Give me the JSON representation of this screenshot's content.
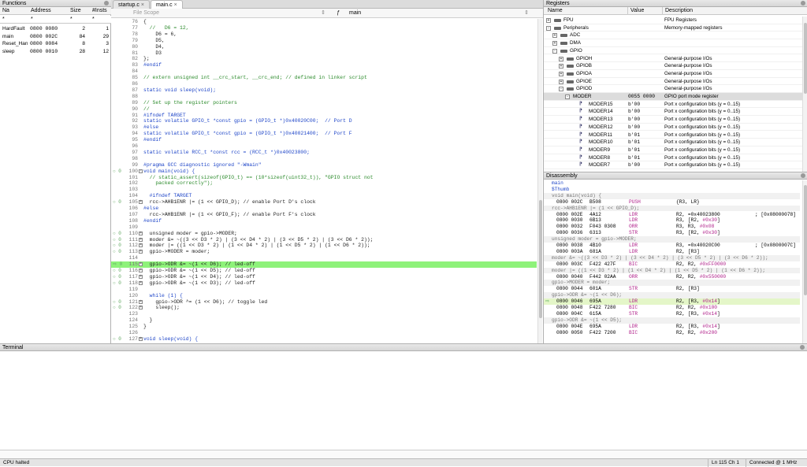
{
  "functions": {
    "title": "Functions",
    "columns": [
      "Na",
      "Address",
      "Size",
      "#Insts"
    ],
    "filters": [
      "*",
      "*",
      "*",
      "*"
    ],
    "rows": [
      {
        "name": "HardFault",
        "address": "0800 0080",
        "size": "2",
        "insts": "1"
      },
      {
        "name": "main",
        "address": "0800 002C",
        "size": "84",
        "insts": "29"
      },
      {
        "name": "Reset_Han",
        "address": "0800 0084",
        "size": "8",
        "insts": "3"
      },
      {
        "name": "sleep",
        "address": "0800 0010",
        "size": "28",
        "insts": "12"
      }
    ]
  },
  "editor": {
    "tabs": [
      "startup.c",
      "main.c"
    ],
    "file_scope": "File Scope",
    "func_symbol": "ƒ",
    "func_name": "main",
    "lines": [
      {
        "n": "76",
        "t": "{"
      },
      {
        "n": "77",
        "t": "  //   D6 = 12,",
        "cls": "c"
      },
      {
        "n": "78",
        "t": "    D6 = 6,"
      },
      {
        "n": "79",
        "t": "    D5,"
      },
      {
        "n": "80",
        "t": "    D4,"
      },
      {
        "n": "81",
        "t": "    D3"
      },
      {
        "n": "82",
        "t": "};"
      },
      {
        "n": "83",
        "t": "#endif",
        "cls": "p"
      },
      {
        "n": "84",
        "t": ""
      },
      {
        "n": "85",
        "t": "// extern unsigned int __crc_start, __crc_end; // defined in linker script",
        "cls": "c"
      },
      {
        "n": "86",
        "t": ""
      },
      {
        "n": "87",
        "t": "static void sleep(void);",
        "cls": "k"
      },
      {
        "n": "88",
        "t": ""
      },
      {
        "n": "89",
        "t": "// Set up the register pointers",
        "cls": "c"
      },
      {
        "n": "90",
        "t": "//",
        "cls": "c"
      },
      {
        "n": "91",
        "t": "#ifndef TARGET",
        "cls": "p"
      },
      {
        "n": "92",
        "t": "static volatile GPIO_t *const gpio = (GPIO_t *)0x40020C00;  // Port D",
        "cls": "k"
      },
      {
        "n": "93",
        "t": "#else",
        "cls": "p"
      },
      {
        "n": "94",
        "t": "static volatile GPIO_t *const gpio = (GPIO_t *)0x40021400;  // Port F",
        "cls": "k"
      },
      {
        "n": "95",
        "t": "#endif",
        "cls": "p"
      },
      {
        "n": "96",
        "t": ""
      },
      {
        "n": "97",
        "t": "static volatile RCC_t *const rcc = (RCC_t *)0x40023800;",
        "cls": "k"
      },
      {
        "n": "98",
        "t": ""
      },
      {
        "n": "99",
        "t": "#pragma GCC diagnostic ignored \"-Wmain\"",
        "cls": "p"
      },
      {
        "n": "100",
        "t": "void main(void) {",
        "cls": "k",
        "g": "○",
        "e": "-"
      },
      {
        "n": "101",
        "t": "  // static_assert(sizeof(GPIO_t) == (10*sizeof(uint32_t)), \"GPIO struct not",
        "cls": "c"
      },
      {
        "n": "102",
        "t": "    packed correctly\");",
        "cls": "c"
      },
      {
        "n": "103",
        "t": ""
      },
      {
        "n": "104",
        "t": "  #ifndef TARGET",
        "cls": "p"
      },
      {
        "n": "105",
        "t": "  rcc->AHB1ENR |= (1 << GPIO_D); // enable Port D's clock",
        "g": "○",
        "e": "+"
      },
      {
        "n": "106",
        "t": "#else",
        "cls": "p"
      },
      {
        "n": "107",
        "t": "  rcc->AHB1ENR |= (1 << GPIO_F); // enable Port F's clock"
      },
      {
        "n": "108",
        "t": "#endif",
        "cls": "p"
      },
      {
        "n": "109",
        "t": ""
      },
      {
        "n": "110",
        "t": "  unsigned moder = gpio->MODER;",
        "g": "○",
        "e": "+"
      },
      {
        "n": "111",
        "t": "  moder &= ~((3 << D3 * 2) | (3 << D4 * 2) | (3 << D5 * 2) | (3 << D6 * 2));",
        "g": "○",
        "e": "+"
      },
      {
        "n": "112",
        "t": "  moder |= ((1 << D3 * 2) | (1 << D4 * 2) | (1 << D5 * 2) | (1 << D6 * 2));",
        "g": "○",
        "e": "+"
      },
      {
        "n": "113",
        "t": "  gpio->MODER = moder;",
        "g": "○",
        "e": "+"
      },
      {
        "n": "114",
        "t": ""
      },
      {
        "n": "115",
        "t": "  gpio->ODR &= ~(1 << D6); // led-off",
        "g": "⇨",
        "e": "+",
        "hl": true
      },
      {
        "n": "116",
        "t": "  gpio->ODR &= ~(1 << D5); // led-off",
        "g": "○",
        "e": "+"
      },
      {
        "n": "117",
        "t": "  gpio->ODR &= ~(1 << D4); // led-off",
        "g": "○",
        "e": "+"
      },
      {
        "n": "118",
        "t": "  gpio->ODR &= ~(1 << D3); // led-off",
        "g": "○",
        "e": "+"
      },
      {
        "n": "119",
        "t": ""
      },
      {
        "n": "120",
        "t": "  while (1) {",
        "cls": "k"
      },
      {
        "n": "121",
        "t": "    gpio->ODR ^= (1 << D6); // toggle led",
        "g": "○",
        "e": "+"
      },
      {
        "n": "122",
        "t": "    sleep();",
        "g": "○",
        "e": "+"
      },
      {
        "n": "123",
        "t": ""
      },
      {
        "n": "124",
        "t": "  }"
      },
      {
        "n": "125",
        "t": "}"
      },
      {
        "n": "126",
        "t": ""
      },
      {
        "n": "127",
        "t": "void sleep(void) {",
        "cls": "k",
        "g": "○",
        "e": "+"
      }
    ]
  },
  "registers": {
    "title": "Registers",
    "columns": [
      "Name",
      "Value",
      "Description"
    ],
    "rows": [
      {
        "indent": 0,
        "exp": "+",
        "icon": "chip",
        "name": "FPU",
        "value": "",
        "desc": "FPU Registers"
      },
      {
        "indent": 0,
        "exp": "-",
        "icon": "chip",
        "name": "Peripherals",
        "value": "",
        "desc": "Memory-mapped registers"
      },
      {
        "indent": 1,
        "exp": "+",
        "icon": "chip",
        "name": "ADC",
        "value": "",
        "desc": ""
      },
      {
        "indent": 1,
        "exp": "+",
        "icon": "chip",
        "name": "DMA",
        "value": "",
        "desc": ""
      },
      {
        "indent": 1,
        "exp": "-",
        "icon": "chip",
        "name": "GPIO",
        "value": "",
        "desc": ""
      },
      {
        "indent": 2,
        "exp": "+",
        "icon": "chip",
        "name": "GPIOH",
        "value": "",
        "desc": "General-purpose I/Os"
      },
      {
        "indent": 2,
        "exp": "+",
        "icon": "chip",
        "name": "GPIOB",
        "value": "",
        "desc": "General-purpose I/Os"
      },
      {
        "indent": 2,
        "exp": "+",
        "icon": "chip",
        "name": "GPIOA",
        "value": "",
        "desc": "General-purpose I/Os"
      },
      {
        "indent": 2,
        "exp": "+",
        "icon": "chip",
        "name": "GPIOE",
        "value": "",
        "desc": "General-purpose I/Os"
      },
      {
        "indent": 2,
        "exp": "-",
        "icon": "chip",
        "name": "GPIOD",
        "value": "",
        "desc": "General-purpose I/Os"
      },
      {
        "indent": 3,
        "exp": "-",
        "icon": "",
        "name": "MODER",
        "value": "0055 0000",
        "desc": "GPIO port mode register",
        "sel": true
      },
      {
        "indent": 4,
        "exp": "",
        "icon": "field",
        "name": "MODER15",
        "value": "b'00",
        "desc": "Port x configuration bits (y = 0..15)"
      },
      {
        "indent": 4,
        "exp": "",
        "icon": "field",
        "name": "MODER14",
        "value": "b'00",
        "desc": "Port x configuration bits (y = 0..15)"
      },
      {
        "indent": 4,
        "exp": "",
        "icon": "field",
        "name": "MODER13",
        "value": "b'00",
        "desc": "Port x configuration bits (y = 0..15)"
      },
      {
        "indent": 4,
        "exp": "",
        "icon": "field",
        "name": "MODER12",
        "value": "b'00",
        "desc": "Port x configuration bits (y = 0..15)"
      },
      {
        "indent": 4,
        "exp": "",
        "icon": "field",
        "name": "MODER11",
        "value": "b'01",
        "desc": "Port x configuration bits (y = 0..15)"
      },
      {
        "indent": 4,
        "exp": "",
        "icon": "field",
        "name": "MODER10",
        "value": "b'01",
        "desc": "Port x configuration bits (y = 0..15)"
      },
      {
        "indent": 4,
        "exp": "",
        "icon": "field",
        "name": "MODER9",
        "value": "b'01",
        "desc": "Port x configuration bits (y = 0..15)"
      },
      {
        "indent": 4,
        "exp": "",
        "icon": "field",
        "name": "MODER8",
        "value": "b'01",
        "desc": "Port x configuration bits (y = 0..15)"
      },
      {
        "indent": 4,
        "exp": "",
        "icon": "field",
        "name": "MODER7",
        "value": "b'00",
        "desc": "Port x configuration bits (y = 0..15)"
      }
    ]
  },
  "disassembly": {
    "title": "Disassembly",
    "lines": [
      {
        "src": "main",
        "cls": "label"
      },
      {
        "src": "$Thumb",
        "cls": "label"
      },
      {
        "src": "void main(void) {",
        "cls": "src"
      },
      {
        "addr": "0800 002C",
        "hex": "B508",
        "op": "PUSH",
        "args": "{R3, LR}",
        "cm": ""
      },
      {
        "src": "rcc->AHB1ENR |= (1 << GPIO_D);",
        "cls": "src"
      },
      {
        "addr": "0800 002E",
        "hex": "4A12",
        "op": "LDR",
        "args": "R2, =0x40023800",
        "cm": "; [0x08000078]"
      },
      {
        "addr": "0800 0030",
        "hex": "6B13",
        "op": "LDR",
        "args": "R3, [R2, #0x30]",
        "cm": ""
      },
      {
        "addr": "0800 0032",
        "hex": "F043 0308",
        "op": "ORR",
        "args": "R3, R3, #0x08",
        "cm": ""
      },
      {
        "addr": "0800 0036",
        "hex": "6313",
        "op": "STR",
        "args": "R3, [R2, #0x30]",
        "cm": ""
      },
      {
        "src": "unsigned moder = gpio->MODER;",
        "cls": "src"
      },
      {
        "addr": "0800 0038",
        "hex": "4B10",
        "op": "LDR",
        "args": "R3, =0x40020C00",
        "cm": "; [0x0800007C]"
      },
      {
        "addr": "0800 003A",
        "hex": "681A",
        "op": "LDR",
        "args": "R2, [R3]",
        "cm": ""
      },
      {
        "src": "moder &= ~((3 << D3 * 2) | (3 << D4 * 2) | (3 << D5 * 2) | (3 << D6 * 2));",
        "cls": "src"
      },
      {
        "addr": "0800 003C",
        "hex": "F422 427F",
        "op": "BIC",
        "args": "R2, R2, #0xFF0000",
        "cm": ""
      },
      {
        "src": "moder |= ((1 << D3 * 2) | (1 << D4 * 2) | (1 << D5 * 2) | (1 << D6 * 2));",
        "cls": "src"
      },
      {
        "addr": "0800 0040",
        "hex": "F442 02AA",
        "op": "ORR",
        "args": "R2, R2, #0x550000",
        "cm": ""
      },
      {
        "src": "gpio->MODER = moder;",
        "cls": "src"
      },
      {
        "addr": "0800 0044",
        "hex": "601A",
        "op": "STR",
        "args": "R2, [R3]",
        "cm": ""
      },
      {
        "src": "gpio->ODR &= ~(1 << D6);",
        "cls": "src"
      },
      {
        "addr": "0800 0046",
        "hex": "695A",
        "op": "LDR",
        "args": "R2, [R3, #0x14]",
        "cm": "",
        "cur": true
      },
      {
        "addr": "0800 0048",
        "hex": "F422 7280",
        "op": "BIC",
        "args": "R2, R2, #0x100",
        "cm": ""
      },
      {
        "addr": "0800 004C",
        "hex": "615A",
        "op": "STR",
        "args": "R2, [R3, #0x14]",
        "cm": ""
      },
      {
        "src": "gpio->ODR &= ~(1 << D5);",
        "cls": "src"
      },
      {
        "addr": "0800 004E",
        "hex": "695A",
        "op": "LDR",
        "args": "R2, [R3, #0x14]",
        "cm": ""
      },
      {
        "addr": "0800 0050",
        "hex": "F422 7200",
        "op": "BIC",
        "args": "R2, R2, #0x200",
        "cm": ""
      }
    ]
  },
  "terminal": {
    "title": "Terminal"
  },
  "status": {
    "state": "CPU halted",
    "position": "Ln 115  Ch 1",
    "connection": "Connected @ 1 MHz"
  }
}
